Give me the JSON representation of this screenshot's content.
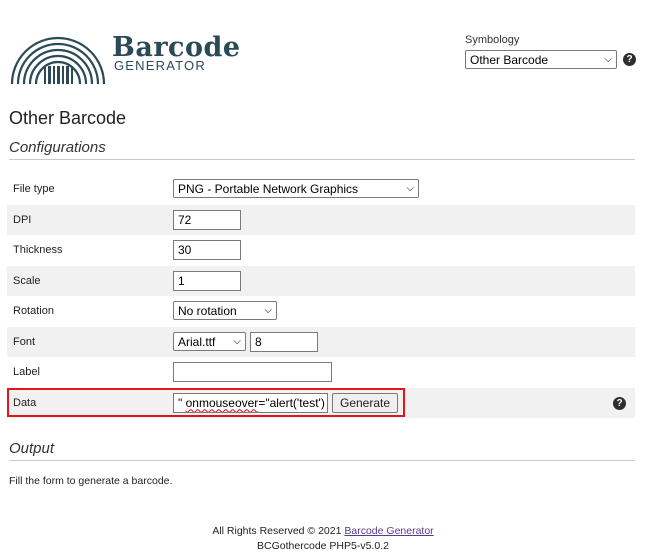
{
  "header": {
    "logo_line1": "Barcode",
    "logo_line2": "GENERATOR",
    "symbology_label": "Symbology",
    "symbology_value": "Other Barcode"
  },
  "page_title": "Other Barcode",
  "config_title": "Configurations",
  "form": {
    "file_type": {
      "label": "File type",
      "value": "PNG - Portable Network Graphics"
    },
    "dpi": {
      "label": "DPI",
      "value": "72"
    },
    "thickness": {
      "label": "Thickness",
      "value": "30"
    },
    "scale": {
      "label": "Scale",
      "value": "1"
    },
    "rotation": {
      "label": "Rotation",
      "value": "No rotation"
    },
    "font": {
      "label": "Font",
      "value": "Arial.ttf",
      "size": "8"
    },
    "label": {
      "label": "Label",
      "value": ""
    },
    "data": {
      "label": "Data",
      "value_prefix": "\" ",
      "value_word": "onmouseover",
      "value_suffix": "=\"alert('test')",
      "button": "Generate"
    }
  },
  "output_title": "Output",
  "output_message": "Fill the form to generate a barcode.",
  "footer": {
    "rights": "All Rights Reserved © 2021 ",
    "link": "Barcode Generator",
    "version": "BCGothercode PHP5-v5.0.2"
  },
  "colors": {
    "highlight": "#e0161e",
    "logo": "#2a4a58",
    "link": "#5a3a8a"
  }
}
